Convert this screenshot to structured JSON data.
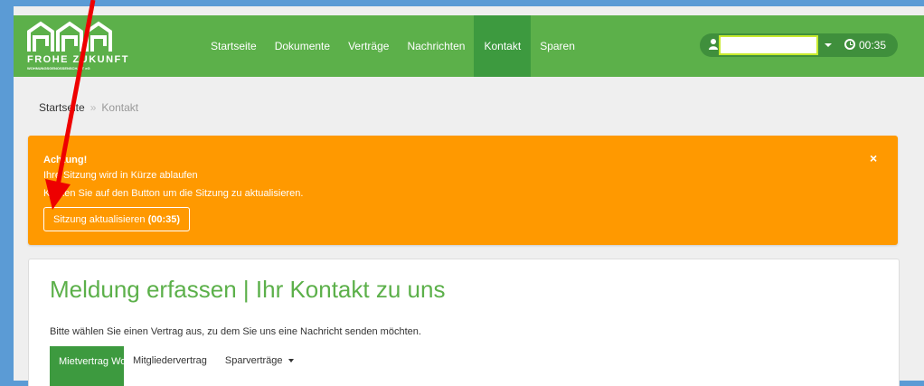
{
  "logo": {
    "main": "FROHE ZUKUNFT",
    "sub": "WOHNUNGSGENOSSENSCHAFT eG"
  },
  "nav": {
    "items": [
      {
        "label": "Startseite",
        "active": false
      },
      {
        "label": "Dokumente",
        "active": false
      },
      {
        "label": "Verträge",
        "active": false
      },
      {
        "label": "Nachrichten",
        "active": false
      },
      {
        "label": "Kontakt",
        "active": true
      },
      {
        "label": "Sparen",
        "active": false
      }
    ]
  },
  "user": {
    "name": "",
    "timer": "00:35"
  },
  "breadcrumb": {
    "home": "Startseite",
    "separator": "»",
    "current": "Kontakt"
  },
  "alert": {
    "title": "Achtung!",
    "line1": "Ihre Sitzung wird in Kürze ablaufen",
    "line2": "Klicken Sie auf den Button um die Sitzung zu aktualisieren.",
    "button_label": "Sitzung aktualisieren ",
    "button_countdown": "(00:35)",
    "close": "×"
  },
  "panel": {
    "title": "Meldung erfassen | Ihr Kontakt zu uns",
    "text": "Bitte wählen Sie einen Vertrag aus, zu dem Sie uns eine Nachricht senden möchten.",
    "tabs": [
      {
        "label": "Mietvertrag Wohnraum",
        "active": true
      },
      {
        "label": "Mitgliedervertrag",
        "active": false
      },
      {
        "label": "Sparverträge",
        "active": false,
        "dropdown": true
      }
    ]
  },
  "colors": {
    "navbar": "#5cb04a",
    "nav_active": "#3d9a3f",
    "alert": "#ff9900",
    "title_green": "#5cb04a",
    "annotation_arrow": "#ee0000"
  }
}
